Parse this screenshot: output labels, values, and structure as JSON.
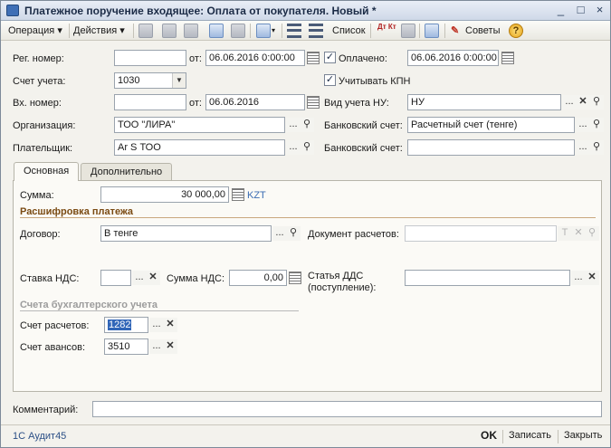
{
  "window": {
    "title": "Платежное поручение входящее: Оплата от покупателя. Новый *",
    "controls": {
      "minimize": "_",
      "maximize": "□",
      "close": "×"
    }
  },
  "toolbar": {
    "operation": "Операция ▾",
    "actions": "Действия ▾",
    "list_label": "Список",
    "dt_kt": "Дт Кт",
    "tips_label": "Советы",
    "help": "?"
  },
  "header": {
    "reg_number_label": "Рег. номер:",
    "reg_number_value": "",
    "reg_from_label": "от:",
    "reg_date": "06.06.2016  0:00:00",
    "paid_label": "Оплачено:",
    "paid_checked": true,
    "paid_date": "06.06.2016  0:00:00",
    "account_label": "Счет учета:",
    "account_value": "1030",
    "kpn_label": "Учитывать КПН",
    "kpn_checked": true,
    "in_number_label": "Вх. номер:",
    "in_number_value": "",
    "in_from_label": "от:",
    "in_date": "06.06.2016",
    "nu_type_label": "Вид учета НУ:",
    "nu_type_value": "НУ",
    "org_label": "Организация:",
    "org_value": "ТОО \"ЛИРА\"",
    "bank_account_label": "Банковский счет:",
    "bank_account_value": "Расчетный счет (тенге)",
    "payer_label": "Плательщик:",
    "payer_value": "Ar S ТОО",
    "payer_bank_label": "Банковский счет:",
    "payer_bank_value": ""
  },
  "tabs": [
    {
      "label": "Основная",
      "active": true
    },
    {
      "label": "Дополнительно",
      "active": false
    }
  ],
  "main": {
    "sum_label": "Сумма:",
    "sum_value": "30 000,00",
    "currency": "KZT",
    "decode_title": "Расшифровка платежа",
    "contract_label": "Договор:",
    "contract_value": "В тенге",
    "settle_doc_label": "Документ расчетов:",
    "settle_doc_value": "",
    "vat_rate_label": "Ставка НДС:",
    "vat_rate_value": "",
    "vat_sum_label": "Сумма НДС:",
    "vat_sum_value": "0,00",
    "dds_label_1": "Статья ДДС",
    "dds_label_2": "(поступление):",
    "dds_value": "",
    "accounts_title": "Счета бухгалтерского учета",
    "settle_acc_label": "Счет расчетов:",
    "settle_acc_value": "1282",
    "advance_acc_label": "Счет авансов:",
    "advance_acc_value": "3510"
  },
  "comment": {
    "label": "Комментарий:",
    "value": ""
  },
  "footer": {
    "left": "1С Аудит45",
    "ok": "OK",
    "save": "Записать",
    "close": "Закрыть"
  },
  "colors": {
    "section_title": "#7a4a12",
    "currency": "#3b6cb3",
    "selection": "#3166b8"
  },
  "icons": [
    "app-icon",
    "doc-icon",
    "copy-icon",
    "post-icon",
    "unpost-icon",
    "move-icon",
    "structure-icon",
    "list-settings-icon",
    "dtkt-icon",
    "report-icon",
    "filter-icon",
    "tips-icon",
    "help-icon",
    "calendar-icon",
    "select-icon",
    "search-icon",
    "clear-icon",
    "calculator-icon",
    "dropdown-icon",
    "checkbox-icon"
  ]
}
